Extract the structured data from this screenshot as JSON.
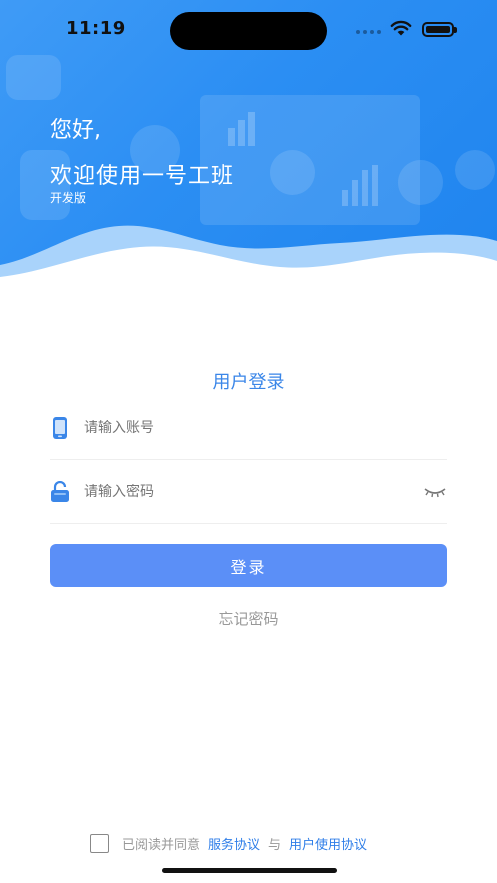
{
  "status_bar": {
    "time": "11:19",
    "icons": [
      "signal-dots-icon",
      "wifi-icon",
      "battery-icon"
    ]
  },
  "header": {
    "greeting_line1": "您好,",
    "greeting_line2": "欢迎使用一号工班",
    "edition": "开发版"
  },
  "login": {
    "title": "用户登录",
    "account_placeholder": "请输入账号",
    "password_placeholder": "请输入密码",
    "account_icon": "phone-icon",
    "password_icon": "lock-icon",
    "password_toggle_icon": "eye-closed-icon",
    "submit_label": "登录",
    "forgot_label": "忘记密码"
  },
  "agreement": {
    "prefix": "已阅读并同意",
    "service_link": "服务协议",
    "conjunction": "与",
    "user_link": "用户使用协议",
    "checked": false
  },
  "colors": {
    "header_blue": "#2b8ef3",
    "button_blue": "#5b8ff7",
    "link_blue": "#2f7ee8",
    "title_blue": "#3a86e8"
  }
}
